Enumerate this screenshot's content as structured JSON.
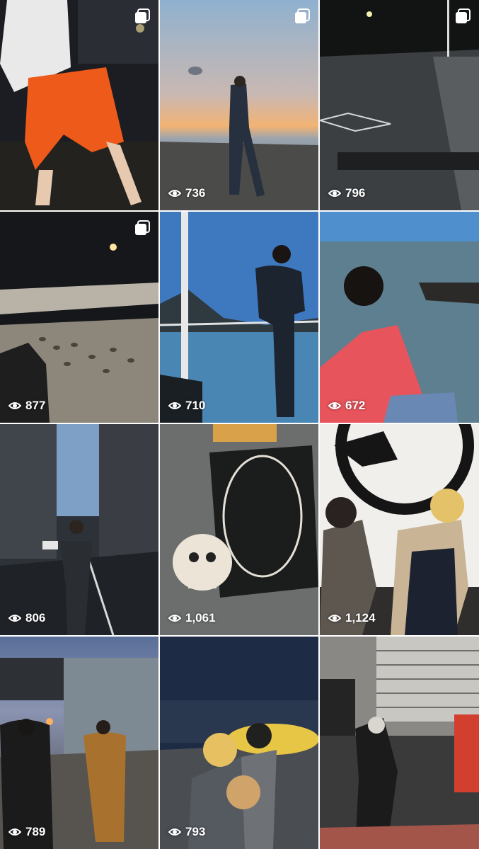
{
  "grid": {
    "posts": [
      {
        "views": "",
        "multi": true,
        "icon": "carousel-icon",
        "scene": "person in orange shorts at night"
      },
      {
        "views": "736",
        "multi": true,
        "icon": "carousel-icon",
        "scene": "silhouette at seaside sunset"
      },
      {
        "views": "796",
        "multi": true,
        "icon": "carousel-icon",
        "scene": "person lying on night street"
      },
      {
        "views": "877",
        "multi": true,
        "icon": "carousel-icon",
        "scene": "pier at night with ducks"
      },
      {
        "views": "710",
        "multi": false,
        "scene": "person on ferry deck"
      },
      {
        "views": "672",
        "multi": false,
        "scene": "person in red shirt by sea"
      },
      {
        "views": "806",
        "multi": false,
        "scene": "person walking city street"
      },
      {
        "views": "1,061",
        "multi": false,
        "scene": "denim with patches"
      },
      {
        "views": "1,124",
        "multi": false,
        "scene": "two people by mural"
      },
      {
        "views": "789",
        "multi": false,
        "scene": "two people walking shopping street"
      },
      {
        "views": "793",
        "multi": false,
        "scene": "two people by boat at dusk"
      },
      {
        "views": "",
        "multi": false,
        "scene": "person crouching by shutter"
      }
    ],
    "view_icon": "eye-icon"
  }
}
